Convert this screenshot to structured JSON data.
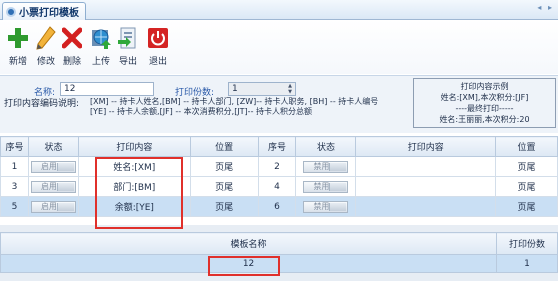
{
  "tab": {
    "title": "小票打印模板",
    "arrows": "◂ ▸"
  },
  "toolbar": [
    {
      "key": "add",
      "label": "新增"
    },
    {
      "key": "edit",
      "label": "修改"
    },
    {
      "key": "delete",
      "label": "删除"
    },
    {
      "key": "upload",
      "label": "上传"
    },
    {
      "key": "export",
      "label": "导出"
    },
    {
      "key": "exit",
      "label": "退出"
    }
  ],
  "settings": {
    "name_label": "名称:",
    "name_value": "12",
    "copies_label": "打印份数:",
    "copies_value": "1",
    "codes_label": "打印内容编码说明:",
    "codes_line1": "[XM] -- 持卡人姓名,[BM] -- 持卡人部门, [ZW]-- 持卡人职务,      [BH] -- 持卡人编号",
    "codes_line2": "[YE] -- 持卡人余额,[JF] -- 本次消费积分,[JT]-- 持卡人积分总额"
  },
  "example": {
    "title": "打印内容示例",
    "line1": "姓名:[XM],本次积分:[JF]",
    "line2": "----最终打印-----",
    "line3": "姓名:王丽丽,本次积分:20"
  },
  "grid": {
    "headers": [
      "序号",
      "状态",
      "打印内容",
      "位置",
      "序号",
      "状态",
      "打印内容",
      "位置"
    ],
    "rows": [
      {
        "n1": "1",
        "s1": "启用",
        "c1": "姓名:[XM]",
        "p1": "页尾",
        "n2": "2",
        "s2": "禁用",
        "c2": "",
        "p2": "页尾"
      },
      {
        "n1": "3",
        "s1": "启用",
        "c1": "部门:[BM]",
        "p1": "页尾",
        "n2": "4",
        "s2": "禁用",
        "c2": "",
        "p2": "页尾"
      },
      {
        "n1": "5",
        "s1": "启用",
        "c1": "余额:[YE]",
        "p1": "页尾",
        "n2": "6",
        "s2": "禁用",
        "c2": "",
        "p2": "页尾"
      }
    ]
  },
  "template_table": {
    "headers": [
      "模板名称",
      "打印份数"
    ],
    "rows": [
      {
        "name": "12",
        "copies": "1"
      }
    ]
  },
  "colors": {
    "accent_red": "#e0302b",
    "selected_row": "#c9dff4",
    "header_blue": "#2858a8"
  }
}
